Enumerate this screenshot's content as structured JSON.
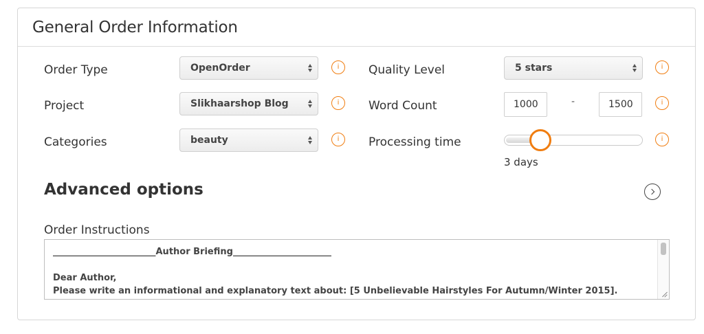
{
  "panel": {
    "title": "General Order Information"
  },
  "form": {
    "order_type": {
      "label": "Order Type",
      "value": "OpenOrder"
    },
    "project": {
      "label": "Project",
      "value": "Slikhaarshop Blog"
    },
    "categories": {
      "label": "Categories",
      "value": "beauty"
    },
    "quality_level": {
      "label": "Quality Level",
      "value": "5 stars"
    },
    "word_count": {
      "label": "Word Count",
      "min": "1000",
      "separator": "-",
      "max": "1500"
    },
    "processing_time": {
      "label": "Processing time",
      "value_text": "3 days",
      "slider_fraction": 0.25
    },
    "info_icon_glyph": "i"
  },
  "advanced": {
    "title": "Advanced options"
  },
  "instructions": {
    "label": "Order Instructions",
    "lines": [
      "_______________________Author Briefing______________________",
      "",
      "Dear Author,",
      "Please write an informational and explanatory text about: [5 Unbelievable Hairstyles For Autumn/Winter 2015]."
    ]
  },
  "colors": {
    "accent": "#f07d10",
    "border": "#d6d6d6",
    "text": "#333333"
  }
}
